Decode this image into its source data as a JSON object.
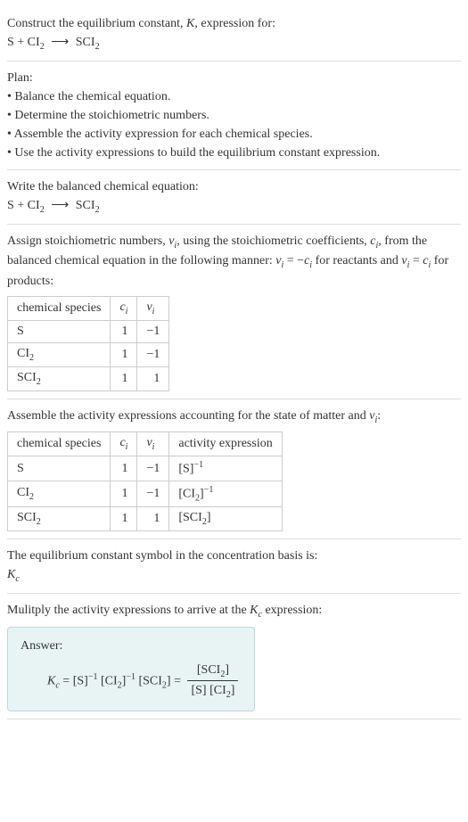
{
  "header": {
    "title_prefix": "Construct the equilibrium constant, ",
    "title_var": "K",
    "title_suffix": ", expression for:",
    "equation_left": "S + CI",
    "equation_sub": "2",
    "equation_right": "SCI",
    "equation_right_sub": "2"
  },
  "plan": {
    "title": "Plan:",
    "items": [
      "• Balance the chemical equation.",
      "• Determine the stoichiometric numbers.",
      "• Assemble the activity expression for each chemical species.",
      "• Use the activity expressions to build the equilibrium constant expression."
    ]
  },
  "balanced": {
    "title": "Write the balanced chemical equation:",
    "left": "S + CI",
    "sub1": "2",
    "right": "SCI",
    "sub2": "2"
  },
  "stoich": {
    "text1": "Assign stoichiometric numbers, ",
    "var1": "ν",
    "sub1": "i",
    "text2": ", using the stoichiometric coefficients, ",
    "var2": "c",
    "sub2": "i",
    "text3": ", from the balanced chemical equation in the following manner: ",
    "eq1a": "ν",
    "eq1asub": "i",
    "eq1mid": " = −",
    "eq1b": "c",
    "eq1bsub": "i",
    "text4": " for reactants and ",
    "eq2a": "ν",
    "eq2asub": "i",
    "eq2mid": " = ",
    "eq2b": "c",
    "eq2bsub": "i",
    "text5": " for products:",
    "headers": {
      "h1": "chemical species",
      "h2": "c",
      "h2sub": "i",
      "h3": "ν",
      "h3sub": "i"
    },
    "rows": [
      {
        "species": "S",
        "c": "1",
        "v": "−1"
      },
      {
        "species_a": "CI",
        "species_sub": "2",
        "c": "1",
        "v": "−1"
      },
      {
        "species_a": "SCI",
        "species_sub": "2",
        "c": "1",
        "v": "1"
      }
    ]
  },
  "activity": {
    "text1": "Assemble the activity expressions accounting for the state of matter and ",
    "var": "ν",
    "varsub": "i",
    "text2": ":",
    "headers": {
      "h1": "chemical species",
      "h2": "c",
      "h2sub": "i",
      "h3": "ν",
      "h3sub": "i",
      "h4": "activity expression"
    },
    "rows": [
      {
        "species": "S",
        "c": "1",
        "v": "−1",
        "expr": "[S]",
        "sup": "−1"
      },
      {
        "species_a": "CI",
        "species_sub": "2",
        "c": "1",
        "v": "−1",
        "expr_a": "[CI",
        "expr_sub": "2",
        "expr_b": "]",
        "sup": "−1"
      },
      {
        "species_a": "SCI",
        "species_sub": "2",
        "c": "1",
        "v": "1",
        "expr_a": "[SCI",
        "expr_sub": "2",
        "expr_b": "]"
      }
    ]
  },
  "symbol": {
    "text": "The equilibrium constant symbol in the concentration basis is:",
    "var": "K",
    "sub": "c"
  },
  "multiply": {
    "text1": "Mulitply the activity expressions to arrive at the ",
    "var": "K",
    "sub": "c",
    "text2": " expression:"
  },
  "answer": {
    "label": "Answer:",
    "lhs_k": "K",
    "lhs_sub": "c",
    "eq": " = ",
    "t1": "[S]",
    "t1sup": "−1",
    "t2a": " [CI",
    "t2sub": "2",
    "t2b": "]",
    "t2sup": "−1",
    "t3a": " [SCI",
    "t3sub": "2",
    "t3b": "] = ",
    "num_a": "[SCI",
    "num_sub": "2",
    "num_b": "]",
    "den_a": "[S] [CI",
    "den_sub": "2",
    "den_b": "]"
  },
  "chart_data": {
    "type": "table",
    "tables": [
      {
        "title": "Stoichiometric numbers",
        "columns": [
          "chemical species",
          "c_i",
          "ν_i"
        ],
        "rows": [
          [
            "S",
            1,
            -1
          ],
          [
            "CI2",
            1,
            -1
          ],
          [
            "SCI2",
            1,
            1
          ]
        ]
      },
      {
        "title": "Activity expressions",
        "columns": [
          "chemical species",
          "c_i",
          "ν_i",
          "activity expression"
        ],
        "rows": [
          [
            "S",
            1,
            -1,
            "[S]^-1"
          ],
          [
            "CI2",
            1,
            -1,
            "[CI2]^-1"
          ],
          [
            "SCI2",
            1,
            1,
            "[SCI2]"
          ]
        ]
      }
    ]
  }
}
